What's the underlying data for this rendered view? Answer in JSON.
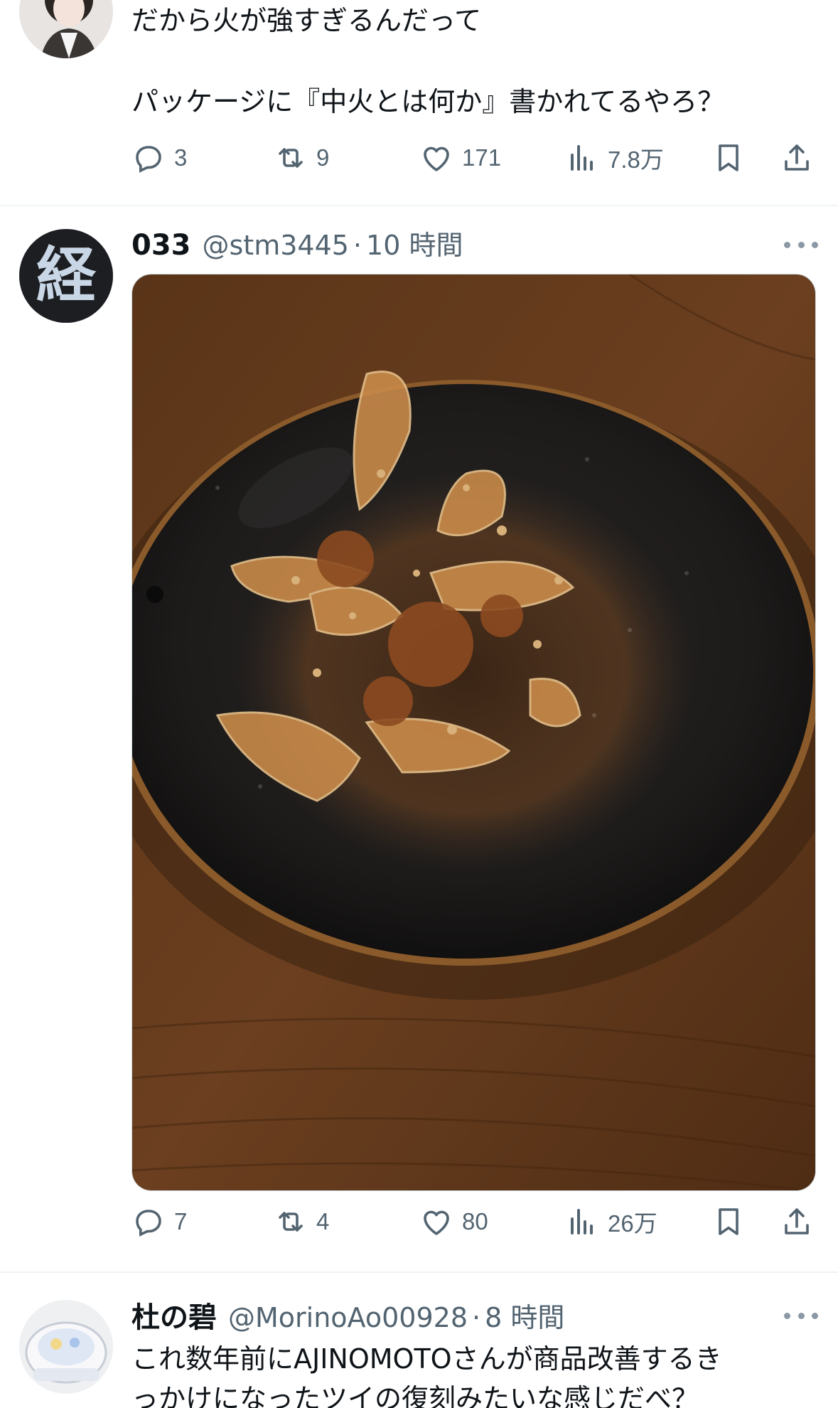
{
  "tweet1": {
    "line1": "だから火が強すぎるんだって",
    "line2": "パッケージに『中火とは何か』書かれてるやろ？",
    "actions": {
      "replies": "3",
      "retweets": "9",
      "likes": "171",
      "views": "7.8万"
    }
  },
  "tweet2": {
    "name": "033",
    "handle": "@stm3445",
    "separator": "·",
    "time": "10 時間",
    "avatar_glyph": "経",
    "actions": {
      "replies": "7",
      "retweets": "4",
      "likes": "80",
      "views": "26万"
    }
  },
  "tweet3": {
    "name": "杜の碧",
    "handle": "@MorinoAo00928",
    "separator": "·",
    "time": "8 時間",
    "line1": "これ数年前にAJINOMOTOさんが商品改善するき",
    "line2": "っかけになったツイの復刻みたいな感じだべ？"
  },
  "icons": {
    "reply": "reply-icon",
    "retweet": "retweet-icon",
    "like": "heart-icon",
    "views": "views-icon",
    "bookmark": "bookmark-icon",
    "share": "share-icon",
    "more": "more-icon"
  },
  "colors": {
    "text": "#0f1419",
    "secondary": "#536471",
    "divider": "#eff3f4"
  }
}
